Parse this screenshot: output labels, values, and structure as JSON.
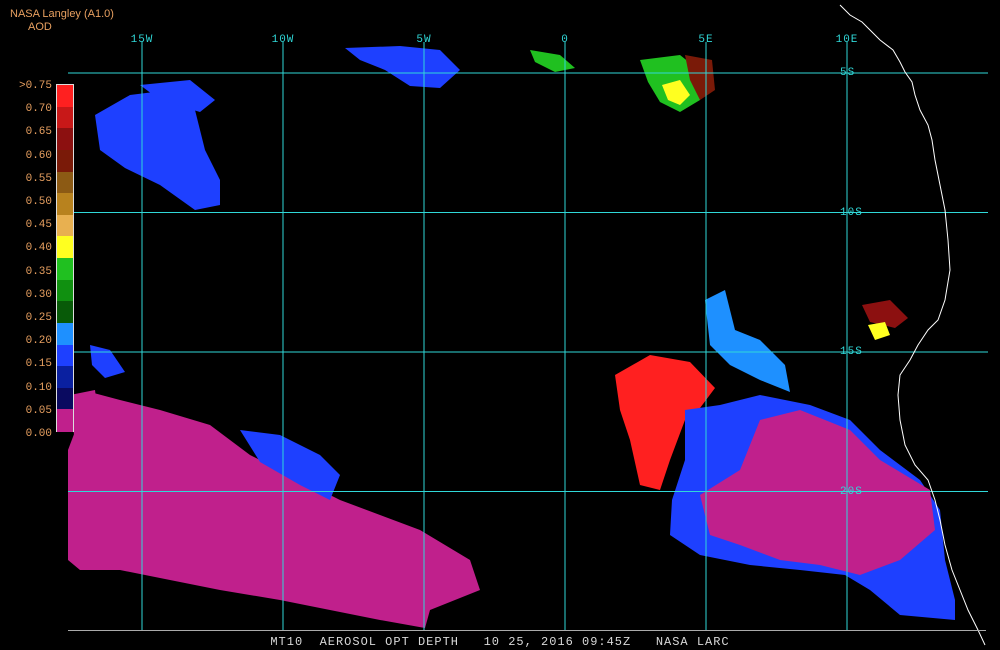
{
  "header": {
    "product": "NASA Langley (A1.0)",
    "variable": "AOD"
  },
  "footer": {
    "caption": "MT10  AEROSOL OPT DEPTH   10 25, 2016 09:45Z   NASA LARC"
  },
  "map": {
    "lon_labels": [
      {
        "lon": -15,
        "text": "15W"
      },
      {
        "lon": -10,
        "text": "10W"
      },
      {
        "lon": -5,
        "text": "5W"
      },
      {
        "lon": 0,
        "text": "0"
      },
      {
        "lon": 5,
        "text": "5E"
      },
      {
        "lon": 10,
        "text": "10E"
      }
    ],
    "lat_labels": [
      {
        "lat": -5,
        "text": "5S"
      },
      {
        "lat": -10,
        "text": "10S"
      },
      {
        "lat": -15,
        "text": "15S"
      },
      {
        "lat": -20,
        "text": "20S"
      }
    ],
    "grid_color": "#30d8d8",
    "coast_color": "#ffffff"
  },
  "colorbar": {
    "labels": [
      ">0.75",
      "0.70",
      "0.65",
      "0.60",
      "0.55",
      "0.50",
      "0.45",
      "0.40",
      "0.35",
      "0.30",
      "0.25",
      "0.20",
      "0.15",
      "0.10",
      "0.05",
      "0.00"
    ],
    "swatches": [
      "#ff2020",
      "#c81818",
      "#8c1010",
      "#7a1a08",
      "#8c5a14",
      "#b8821e",
      "#e8b050",
      "#ffff20",
      "#20c020",
      "#109010",
      "#085a08",
      "#1e90ff",
      "#1e40ff",
      "#0a20a0",
      "#0a0a60",
      "#c0208c"
    ]
  }
}
